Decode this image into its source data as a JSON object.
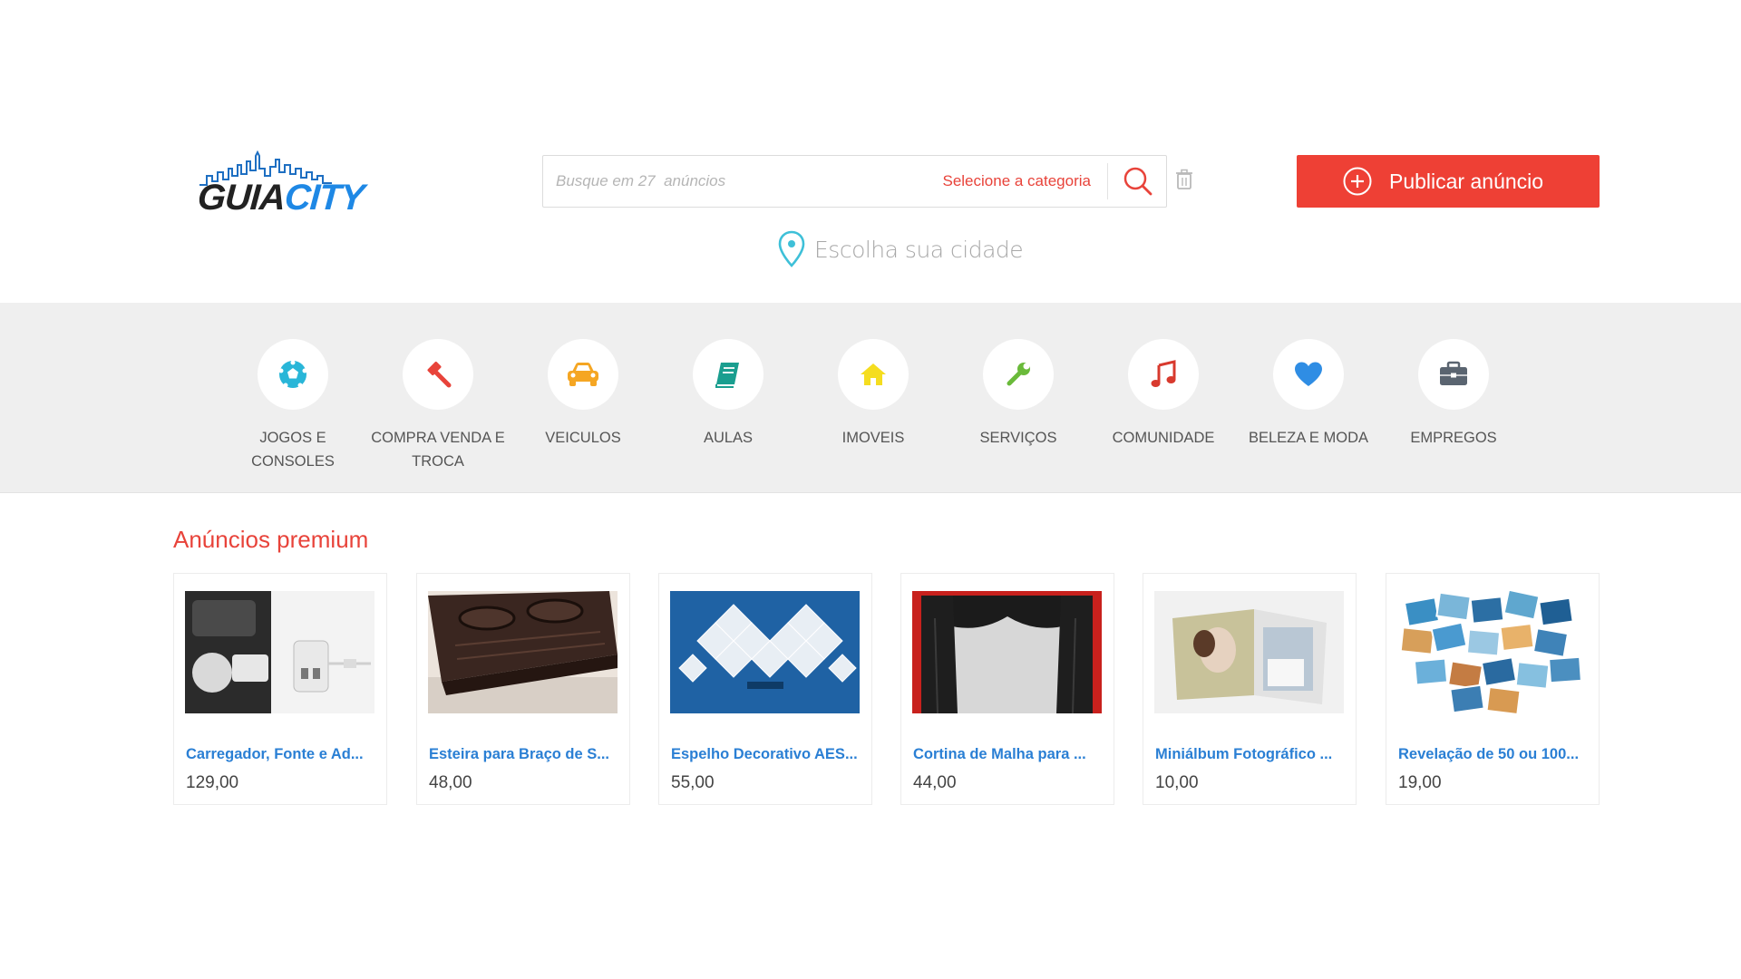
{
  "header": {
    "logo_guia": "GUIA",
    "logo_city": "CITY",
    "search_placeholder": "Busque em 27  anúncios",
    "category_select": "Selecione a categoria",
    "city_picker": "Escolha sua cidade",
    "publish_button": "Publicar anúncio"
  },
  "categories": [
    {
      "label_1": "JOGOS E",
      "label_2": "CONSOLES",
      "icon": "soccer-ball-icon",
      "color": "#29b6d8"
    },
    {
      "label_1": "COMPRA VENDA E",
      "label_2": "TROCA",
      "icon": "gavel-icon",
      "color": "#e8433a"
    },
    {
      "label_1": "VEICULOS",
      "label_2": "",
      "icon": "car-icon",
      "color": "#f5a623"
    },
    {
      "label_1": "AULAS",
      "label_2": "",
      "icon": "book-icon",
      "color": "#1a9e8f"
    },
    {
      "label_1": "IMOVEIS",
      "label_2": "",
      "icon": "home-icon",
      "color": "#f5dd1f"
    },
    {
      "label_1": "SERVIÇOS",
      "label_2": "",
      "icon": "wrench-icon",
      "color": "#6aba3a"
    },
    {
      "label_1": "COMUNIDADE",
      "label_2": "",
      "icon": "music-note-icon",
      "color": "#d83a2e"
    },
    {
      "label_1": "BELEZA E MODA",
      "label_2": "",
      "icon": "heart-icon",
      "color": "#2f8de4"
    },
    {
      "label_1": "EMPREGOS",
      "label_2": "",
      "icon": "briefcase-icon",
      "color": "#5a6470"
    }
  ],
  "premium": {
    "title": "Anúncios premium",
    "items": [
      {
        "title": "Carregador, Fonte e Ad...",
        "price": "129,00"
      },
      {
        "title": "Esteira para Braço de S...",
        "price": "48,00"
      },
      {
        "title": "Espelho Decorativo AES...",
        "price": "55,00"
      },
      {
        "title": "Cortina de Malha para ...",
        "price": "44,00"
      },
      {
        "title": "Miniálbum Fotográfico ...",
        "price": "10,00"
      },
      {
        "title": "Revelação de 50 ou 100...",
        "price": "19,00"
      }
    ]
  },
  "colors": {
    "accent": "#ee4035",
    "link": "#2a7fd4",
    "pin": "#3ec0d8"
  }
}
